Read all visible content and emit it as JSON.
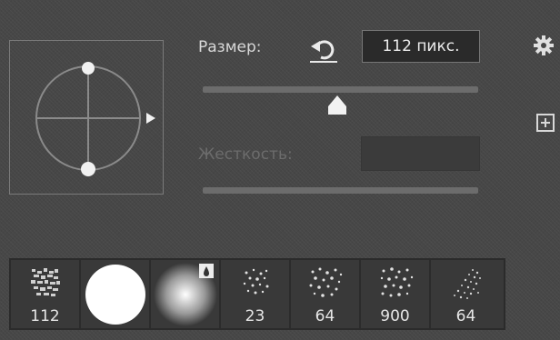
{
  "size": {
    "label": "Размер:",
    "value": "112 пикс.",
    "slider_fraction": 0.49
  },
  "hardness": {
    "label": "Жесткость:",
    "value": ""
  },
  "icons": {
    "reset": "reset-icon",
    "settings": "gear-icon",
    "new_preset": "plus-square-icon",
    "arrow": "triangle-right-icon"
  },
  "brushes": [
    {
      "label": "112",
      "kind": "texture"
    },
    {
      "label": "",
      "kind": "hard-round"
    },
    {
      "label": "",
      "kind": "soft-round"
    },
    {
      "label": "23",
      "kind": "scatter"
    },
    {
      "label": "64",
      "kind": "scatter"
    },
    {
      "label": "900",
      "kind": "scatter"
    },
    {
      "label": "64",
      "kind": "spray"
    }
  ]
}
